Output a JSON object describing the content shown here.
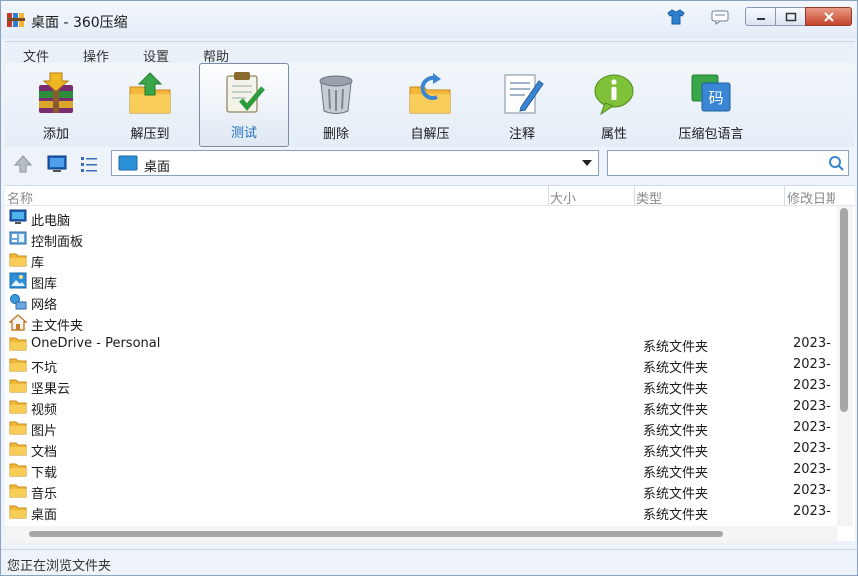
{
  "window": {
    "title": "桌面 - 360压缩"
  },
  "menu": [
    "文件",
    "操作",
    "设置",
    "帮助"
  ],
  "toolbar": [
    {
      "label": "添加",
      "icon": "add-archive-icon"
    },
    {
      "label": "解压到",
      "icon": "extract-folder-icon"
    },
    {
      "label": "测试",
      "icon": "test-clipboard-icon",
      "active": true
    },
    {
      "label": "删除",
      "icon": "trash-bin-icon"
    },
    {
      "label": "自解压",
      "icon": "self-extract-icon"
    },
    {
      "label": "注释",
      "icon": "comment-pencil-icon"
    },
    {
      "label": "属性",
      "icon": "info-bubble-icon"
    },
    {
      "label": "压缩包语言",
      "icon": "language-code-icon"
    }
  ],
  "address": {
    "path": "桌面",
    "search_placeholder": ""
  },
  "columns": {
    "name": "名称",
    "size": "大小",
    "type": "类型",
    "modified": "修改日期"
  },
  "files": [
    {
      "name": "此电脑",
      "type": "",
      "date": "",
      "icon": "computer-icon"
    },
    {
      "name": "控制面板",
      "type": "",
      "date": "",
      "icon": "control-panel-icon"
    },
    {
      "name": "库",
      "type": "",
      "date": "",
      "icon": "folder-icon"
    },
    {
      "name": "图库",
      "type": "",
      "date": "",
      "icon": "gallery-icon"
    },
    {
      "name": "网络",
      "type": "",
      "date": "",
      "icon": "network-icon"
    },
    {
      "name": "主文件夹",
      "type": "",
      "date": "",
      "icon": "home-icon"
    },
    {
      "name": "OneDrive - Personal",
      "type": "系统文件夹",
      "date": "2023-",
      "icon": "folder-icon"
    },
    {
      "name": "不坑",
      "type": "系统文件夹",
      "date": "2023-",
      "icon": "folder-icon"
    },
    {
      "name": "坚果云",
      "type": "系统文件夹",
      "date": "2023-",
      "icon": "folder-icon"
    },
    {
      "name": "视频",
      "type": "系统文件夹",
      "date": "2023-",
      "icon": "folder-icon"
    },
    {
      "name": "图片",
      "type": "系统文件夹",
      "date": "2023-",
      "icon": "folder-icon"
    },
    {
      "name": "文档",
      "type": "系统文件夹",
      "date": "2023-",
      "icon": "folder-icon"
    },
    {
      "name": "下载",
      "type": "系统文件夹",
      "date": "2023-",
      "icon": "folder-icon"
    },
    {
      "name": "音乐",
      "type": "系统文件夹",
      "date": "2023-",
      "icon": "folder-icon"
    },
    {
      "name": "桌面",
      "type": "系统文件夹",
      "date": "2023-",
      "icon": "folder-icon"
    }
  ],
  "status": {
    "text": "您正在浏览文件夹"
  },
  "colors": {
    "accent": "#1a6fc0",
    "folder": "#f6c343",
    "frame": "#eef3f9"
  }
}
